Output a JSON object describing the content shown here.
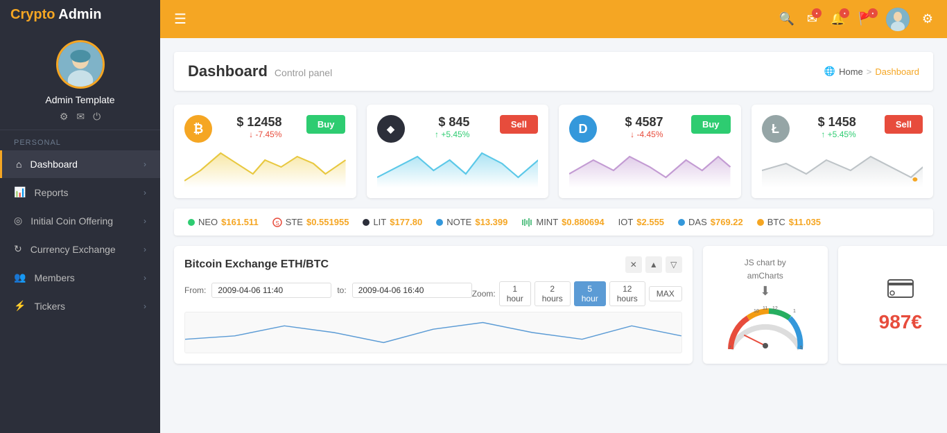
{
  "brand": {
    "crypto": "Crypto",
    "admin": " Admin"
  },
  "profile": {
    "name": "Admin Template",
    "icons": [
      "gear",
      "mail",
      "power"
    ]
  },
  "sidebar": {
    "section_label": "PERSONAL",
    "items": [
      {
        "id": "dashboard",
        "label": "Dashboard",
        "icon": "home",
        "active": true
      },
      {
        "id": "reports",
        "label": "Reports",
        "icon": "bar-chart",
        "active": false
      },
      {
        "id": "ico",
        "label": "Initial Coin Offering",
        "icon": "circle-dots",
        "active": false
      },
      {
        "id": "currency-exchange",
        "label": "Currency Exchange",
        "icon": "refresh",
        "active": false
      },
      {
        "id": "members",
        "label": "Members",
        "icon": "users",
        "active": false
      },
      {
        "id": "tickers",
        "label": "Tickers",
        "icon": "sliders",
        "active": false
      }
    ]
  },
  "topbar": {
    "hamburger_label": "☰"
  },
  "page": {
    "title": "Dashboard",
    "subtitle": "Control panel",
    "breadcrumb": {
      "home": "Home",
      "separator": ">",
      "current": "Dashboard"
    }
  },
  "crypto_cards": [
    {
      "symbol": "BTC",
      "icon_char": "₿",
      "icon_bg": "#f5a623",
      "price": "$ 12458",
      "change": "-7.45%",
      "change_dir": "down",
      "action": "Buy",
      "action_type": "buy",
      "chart_color": "#f0d060",
      "chart_fill": "rgba(240,208,80,0.3)"
    },
    {
      "symbol": "ETH",
      "icon_char": "◆",
      "icon_bg": "#2c2f3a",
      "price": "$ 845",
      "change": "+5.45%",
      "change_dir": "up",
      "action": "Sell",
      "action_type": "sell",
      "chart_color": "#5bc8e8",
      "chart_fill": "rgba(91,200,232,0.3)"
    },
    {
      "symbol": "DASH",
      "icon_char": "D",
      "icon_bg": "#3498db",
      "price": "$ 4587",
      "change": "-4.45%",
      "change_dir": "down",
      "action": "Buy",
      "action_type": "buy",
      "chart_color": "#c39bd3",
      "chart_fill": "rgba(195,155,211,0.3)"
    },
    {
      "symbol": "LTC",
      "icon_char": "Ł",
      "icon_bg": "#95a5a6",
      "price": "$ 1458",
      "change": "+5.45%",
      "change_dir": "up",
      "action": "Sell",
      "action_type": "sell",
      "chart_color": "#bdc3c7",
      "chart_fill": "rgba(189,195,199,0.2)"
    }
  ],
  "ticker": [
    {
      "name": "NEO",
      "price": "$161.511",
      "color": "#2ecc71"
    },
    {
      "name": "STE",
      "price": "$0.551955",
      "color": "#e74c3c"
    },
    {
      "name": "LIT",
      "price": "$177.80",
      "color": "#2c2f3a"
    },
    {
      "name": "NOTE",
      "price": "$13.399",
      "color": "#3498db"
    },
    {
      "name": "MINT",
      "price": "$0.880694",
      "color": "#27ae60"
    },
    {
      "name": "IOT",
      "price": "$2.555",
      "color": "#555"
    },
    {
      "name": "DAS",
      "price": "$769.22",
      "color": "#3498db"
    },
    {
      "name": "BTC",
      "price": "$11.035",
      "color": "#f5a623"
    }
  ],
  "exchange_chart": {
    "title": "Bitcoin Exchange ETH/BTC",
    "from_date": "2009-04-06 11:40",
    "to_label": "to:",
    "to_date": "2009-04-06 16:40",
    "zoom_label": "Zoom:",
    "zoom_buttons": [
      {
        "label": "1 hour",
        "id": "1h",
        "active": false
      },
      {
        "label": "2 hours",
        "id": "2h",
        "active": false
      },
      {
        "label": "5 hour",
        "id": "5h",
        "active": true
      },
      {
        "label": "12 hours",
        "id": "12h",
        "active": false
      },
      {
        "label": "MAX",
        "id": "max",
        "active": false
      }
    ],
    "from_label": "From:"
  },
  "amcharts_card": {
    "line1": "JS chart by",
    "line2": "amCharts"
  },
  "euro_card": {
    "value": "987€"
  }
}
